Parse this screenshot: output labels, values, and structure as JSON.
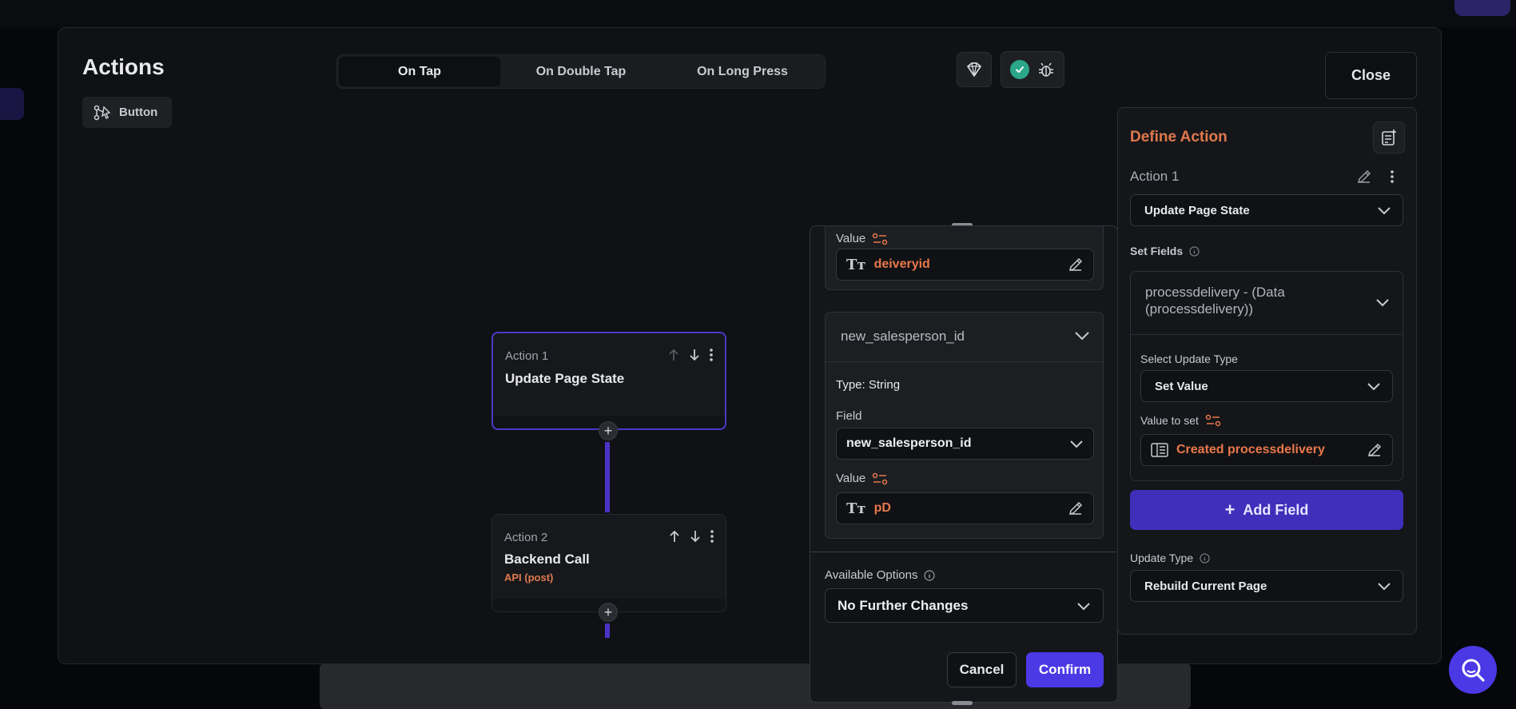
{
  "header": {
    "title": "Actions",
    "widget_chip": "Button",
    "tabs": [
      {
        "label": "On Tap",
        "active": true
      },
      {
        "label": "On Double Tap",
        "active": false
      },
      {
        "label": "On Long Press",
        "active": false
      }
    ],
    "close_label": "Close"
  },
  "flow": {
    "nodes": [
      {
        "label": "Action 1",
        "name": "Update Page State",
        "sub": ""
      },
      {
        "label": "Action 2",
        "name": "Backend Call",
        "sub": "API (post)"
      }
    ]
  },
  "field_panel": {
    "top_value": {
      "label": "Value",
      "text": "deiveryid"
    },
    "field_name": "new_salesperson_id",
    "type_text": "Type: String",
    "field_label": "Field",
    "field_value": "new_salesperson_id",
    "value_label": "Value",
    "value_text": "pD",
    "available_options_label": "Available Options",
    "available_options_value": "No Further Changes",
    "cancel_label": "Cancel",
    "confirm_label": "Confirm"
  },
  "define_action": {
    "title": "Define Action",
    "action_label": "Action 1",
    "action_value": "Update Page State",
    "set_fields_label": "Set Fields",
    "field_line1": "processdelivery - (Data",
    "field_line2": "(processdelivery))",
    "select_update_type_label": "Select Update Type",
    "update_type_value": "Set Value",
    "value_to_set_label": "Value to set",
    "value_to_set": "Created processdelivery",
    "add_field_label": "Add Field",
    "update_type_label": "Update Type",
    "update_type_select": "Rebuild Current Page"
  },
  "colors": {
    "accent": "#4b39e6",
    "orange": "#e9784a",
    "success": "#2ba688"
  }
}
